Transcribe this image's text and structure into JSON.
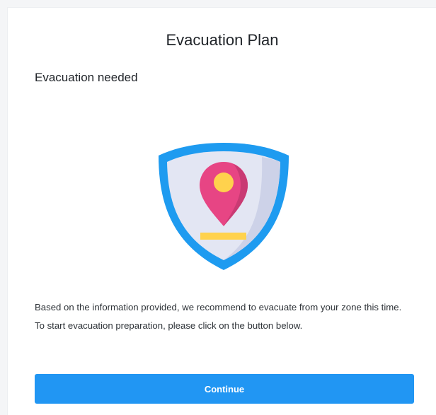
{
  "page": {
    "title": "Evacuation Plan",
    "subtitle": "Evacuation needed",
    "illustration_icon": "shield-location-pin-icon",
    "message": "Based on the information provided, we recommend to evacuate from your zone this time. To start evacuation preparation, please click on the button below.",
    "continue_label": "Continue"
  },
  "colors": {
    "primary_button": "#2196f3",
    "shield_outer": "#1e9bf0",
    "shield_inner": "#e3e6f3",
    "pin": "#e74584",
    "pin_center": "#ffd24d",
    "base_bar": "#ffd24d"
  }
}
